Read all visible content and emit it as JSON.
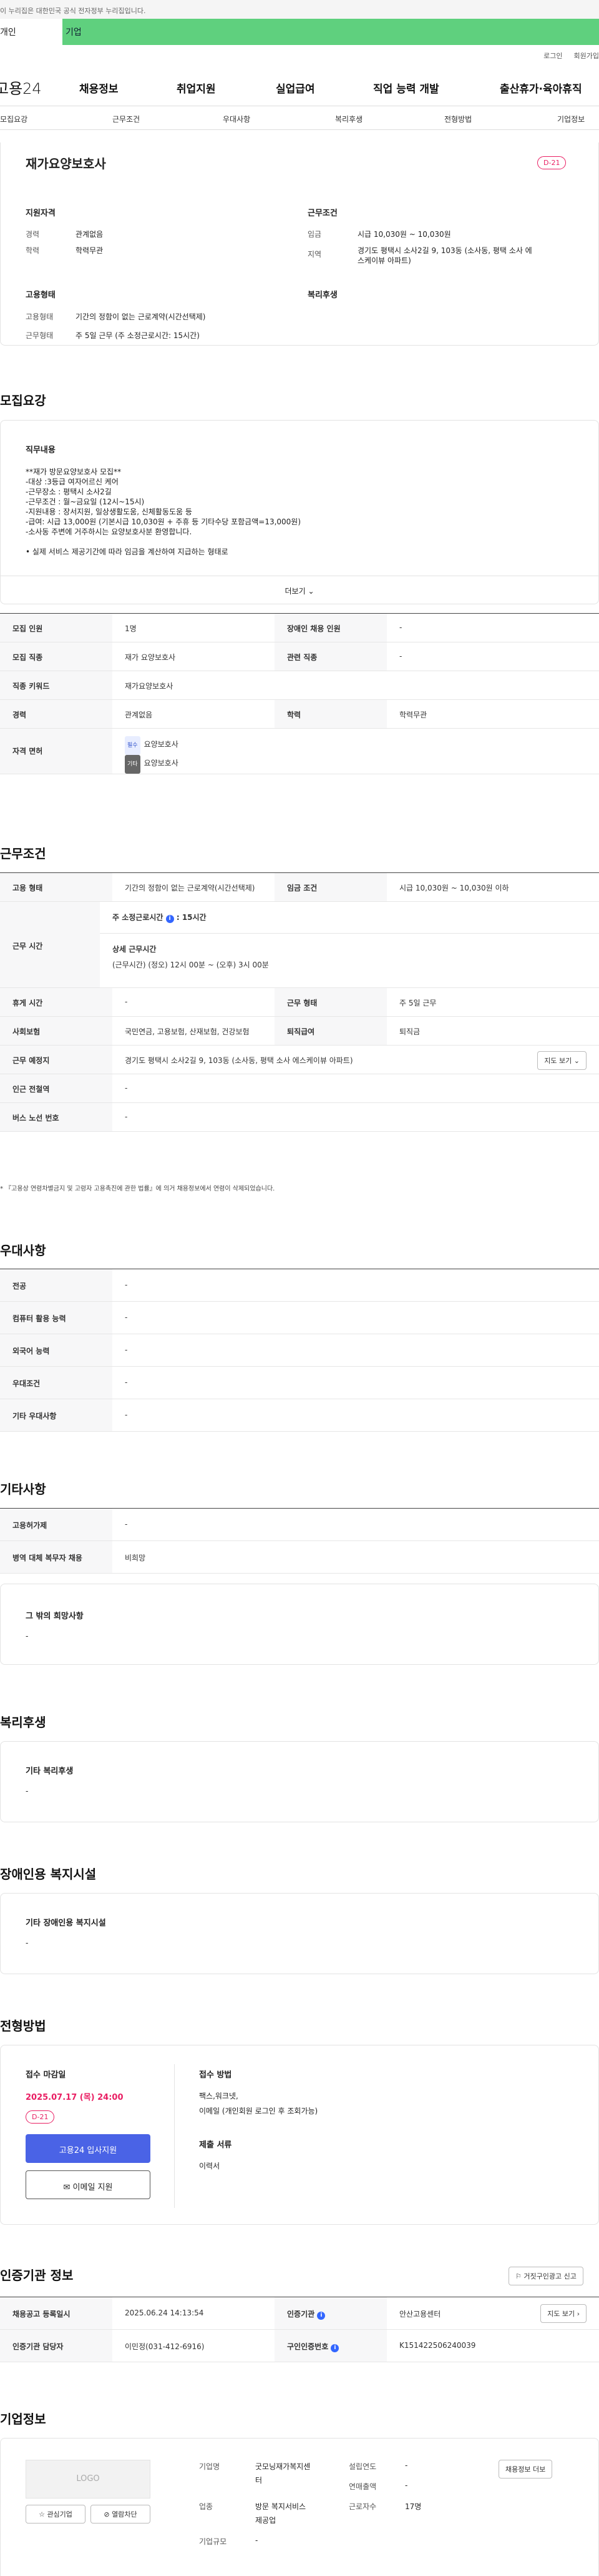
{
  "gov_banner": "이 누리집은 대한민국 공식 전자정부 누리집입니다.",
  "service_tabs": [
    "개인",
    "기업"
  ],
  "util": {
    "login": "로그인",
    "signup": "회원가입"
  },
  "logo": "고용24",
  "gnb": [
    "채용정보",
    "취업지원",
    "실업급여",
    "직업 능력 개발",
    "출산휴가·육아휴직"
  ],
  "anchor_tabs": [
    "모집요강",
    "근무조건",
    "우대사항",
    "복리후생",
    "전형방법",
    "기업정보"
  ],
  "summary": {
    "title": "재가요양보호사",
    "dday": "D-21",
    "qualification_title": "지원자격",
    "career_label": "경력",
    "career": "관계없음",
    "edu_label": "학력",
    "edu": "학력무관",
    "cond_title": "근무조건",
    "wage_label": "임금",
    "wage": "시급 10,030원 ~ 10,030원",
    "region_label": "지역",
    "region_line1": "경기도 평택시 소사2길 9, 103동 (소사동, 평택 소사 에",
    "region_line2": "스케이뷰 아파트)",
    "emp_title": "고용형태",
    "emp_label": "고용형태",
    "emp": "기간의 정함이 없는 근로계약(시간선택제)",
    "work_label": "근무형태",
    "work": "주 5일 근무 (주 소정근로시간: 15시간)",
    "welfare_title": "복리후생"
  },
  "recruit": {
    "heading": "모집요강",
    "duty_title": "직무내용",
    "duty_lines": [
      "**재가 방문요양보호사 모집**",
      "-대상 :3등급 여자어르신 케어",
      "-근무장소 : 평택시 소사2길",
      "-근무조건 : 월~금요일 (12시~15시)",
      "-지원내용 : 장서지원, 일상생활도움, 신체활동도움 등",
      "-급여: 시급 13,000원 (기본시급 10,030원 + 주휴 등 기타수당 포함금액=13,000원)",
      "-소사동 주변에 거주하시는 요양보호사분 환영합니다.",
      "",
      "• 실제 서비스 제공기간에 따라 임금을 계산하여 지급하는 형태로"
    ],
    "more": "더보기",
    "rows": [
      {
        "k1": "모집 인원",
        "v1": "1명",
        "k2": "장애인 채용 인원",
        "v2": "-"
      },
      {
        "k1": "모집 직종",
        "v1": "재가 요양보호사",
        "k2": "관련 직종",
        "v2": "-"
      },
      {
        "k1": "직종 키워드",
        "v1": "재가요양보호사"
      },
      {
        "k1": "경력",
        "v1": "관계없음",
        "k2": "학력",
        "v2": "학력무관"
      }
    ],
    "license_label": "자격 면허",
    "license_tag1": "필수",
    "license_val1": "요양보호사",
    "license_tag2": "기타",
    "license_val2": "요양보호사"
  },
  "conditions": {
    "heading": "근무조건",
    "emp_k": "고용 형태",
    "emp_v": "기간의 정함이 없는 근로계약(시간선택제)",
    "wage_k": "임금 조건",
    "wage_v": "시급 10,030원 ~ 10,030원 이하",
    "hours_k": "근무 시간",
    "hours_main": "주 소정근로시간",
    "hours_value": "15시간",
    "hours_detail_title": "상세 근무시간",
    "hours_detail": "(근무시간) (정오) 12시 00분 ~ (오후) 3시 00분",
    "rest_k": "휴게 시간",
    "rest_v": "-",
    "form_k": "근무 형태",
    "form_v": "주 5일 근무",
    "ins_k": "사회보험",
    "ins_v": "국민연금, 고용보험, 산재보험, 건강보험",
    "sev_k": "퇴직급여",
    "sev_v": "퇴직금",
    "place_k": "근무 예정지",
    "place_v": "경기도 평택시 소사2길 9, 103동 (소사동, 평택 소사 에스케이뷰 아파트)",
    "map_btn": "지도 보기",
    "subway_k": "인근 전철역",
    "subway_v": "-",
    "bus_k": "버스 노선 번호",
    "bus_v": "-",
    "note": "* 『고용상 연령차별금지 및 고령자 고용촉진에 관한 법률』에 의거 채용정보에서 연령이 삭제되었습니다."
  },
  "preferences": {
    "heading": "우대사항",
    "rows": [
      {
        "k": "전공",
        "v": "-"
      },
      {
        "k": "컴퓨터 활용 능력",
        "v": "-"
      },
      {
        "k": "외국어 능력",
        "v": "-"
      },
      {
        "k": "우대조건",
        "v": "-"
      },
      {
        "k": "기타 우대사항",
        "v": "-"
      }
    ]
  },
  "etc": {
    "heading": "기타사항",
    "rows": [
      {
        "k": "고용허가제",
        "v": "-"
      },
      {
        "k": "병역 대체 복무자 채용",
        "v": "비희망"
      }
    ],
    "other_title": "그 밖의 희망사항",
    "other_v": "-"
  },
  "welfare": {
    "heading": "복리후생",
    "title": "기타 복리후생",
    "v": "-"
  },
  "disability": {
    "heading": "장애인용 복지시설",
    "title": "기타 장애인용 복지시설",
    "v": "-"
  },
  "process": {
    "heading": "전형방법",
    "deadline_title": "접수 마감일",
    "deadline": "2025.07.17 (목) 24:00",
    "dday": "D-21",
    "apply_btn": "고용24 입사지원",
    "email_btn": "이메일 지원",
    "method_title": "접수 방법",
    "method_line1": "팩스,워크넷,",
    "method_line2": "이메일 (개인회원 로그인 후 조회가능)",
    "docs_title": "제출 서류",
    "docs": "이력서"
  },
  "cert": {
    "heading": "인증기관 정보",
    "report_btn": "거짓구인광고 신고",
    "reg_k": "채용공고 등록일시",
    "reg_v": "2025.06.24 14:13:54",
    "org_k": "인증기관",
    "org_v": "안산고용센터",
    "map_btn": "지도 보기",
    "mgr_k": "인증기관 담당자",
    "mgr_v": "이민정(031-412-6916)",
    "no_k": "구인인증번호",
    "no_v": "K151422506240039"
  },
  "company": {
    "heading": "기업정보",
    "logo": "LOGO",
    "fav_btn": "관심기업",
    "block_btn": "열람차단",
    "name_k": "기업명",
    "name_v1": "굿모닝재가복지센",
    "name_v2": "터",
    "ind_k": "업종",
    "ind_v1": "방문 복지서비스",
    "ind_v2": "제공업",
    "size_k": "기업규모",
    "size_v": "-",
    "year_k": "설립연도",
    "year_v": "-",
    "sales_k": "연매출액",
    "sales_v": "-",
    "emp_k": "근로자수",
    "emp_v": "17명",
    "info_btn": "채용정보 더보"
  }
}
